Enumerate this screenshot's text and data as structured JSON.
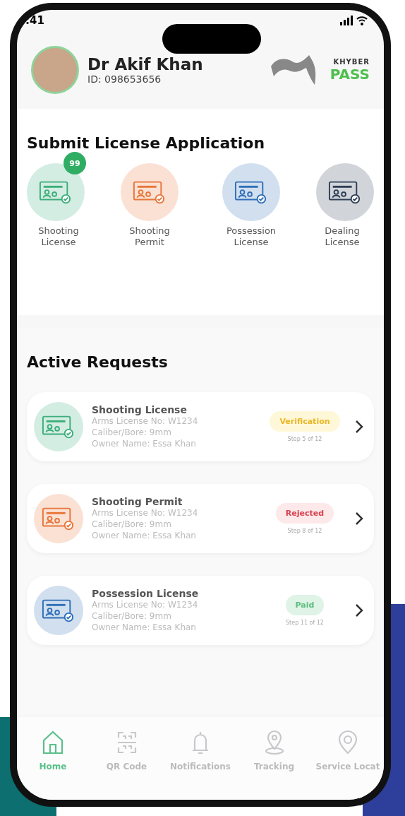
{
  "status_bar": {
    "time": ":41"
  },
  "profile": {
    "name": "Dr Akif Khan",
    "id": "ID: 098653656"
  },
  "logo": {
    "top": "KHYBER",
    "bottom": "PASS"
  },
  "apply_section": {
    "title": "Submit License Application",
    "items": [
      {
        "label": "Shooting License",
        "color": "#3cae7b",
        "badge": "99"
      },
      {
        "label": "Shooting Permit",
        "color": "#e8763a"
      },
      {
        "label": "Possession License",
        "color": "#2f6fb8"
      },
      {
        "label": "Dealing License",
        "color": "#2f3e55"
      }
    ]
  },
  "requests_section": {
    "title": "Active Requests",
    "items": [
      {
        "title": "Shooting License",
        "license": "Arms License No: W1234",
        "caliber": "Caliber/Bore: 9mm",
        "owner": "Owner Name: Essa Khan",
        "color": "#3cae7b",
        "status": "Verification",
        "kind": "verification",
        "step": "Step 5 of 12"
      },
      {
        "title": "Shooting Permit",
        "license": "Arms License No: W1234",
        "caliber": "Caliber/Bore: 9mm",
        "owner": "Owner Name: Essa Khan",
        "color": "#e8763a",
        "status": "Rejected",
        "kind": "rejected",
        "step": "Step 8 of 12"
      },
      {
        "title": "Possession License",
        "license": "Arms License No: W1234",
        "caliber": "Caliber/Bore: 9mm",
        "owner": "Owner Name: Essa Khan",
        "color": "#2f6fb8",
        "status": "Paid",
        "kind": "paid",
        "step": "Step 11 of 12"
      }
    ]
  },
  "bottom_nav": [
    {
      "label": "Home",
      "kind": "home",
      "selected": true
    },
    {
      "label": "QR Code",
      "kind": "qr",
      "selected": false
    },
    {
      "label": "Notifications",
      "kind": "bell",
      "selected": false
    },
    {
      "label": "Tracking",
      "kind": "pin",
      "selected": false
    },
    {
      "label": "Service Locat",
      "kind": "locator",
      "selected": false
    }
  ]
}
